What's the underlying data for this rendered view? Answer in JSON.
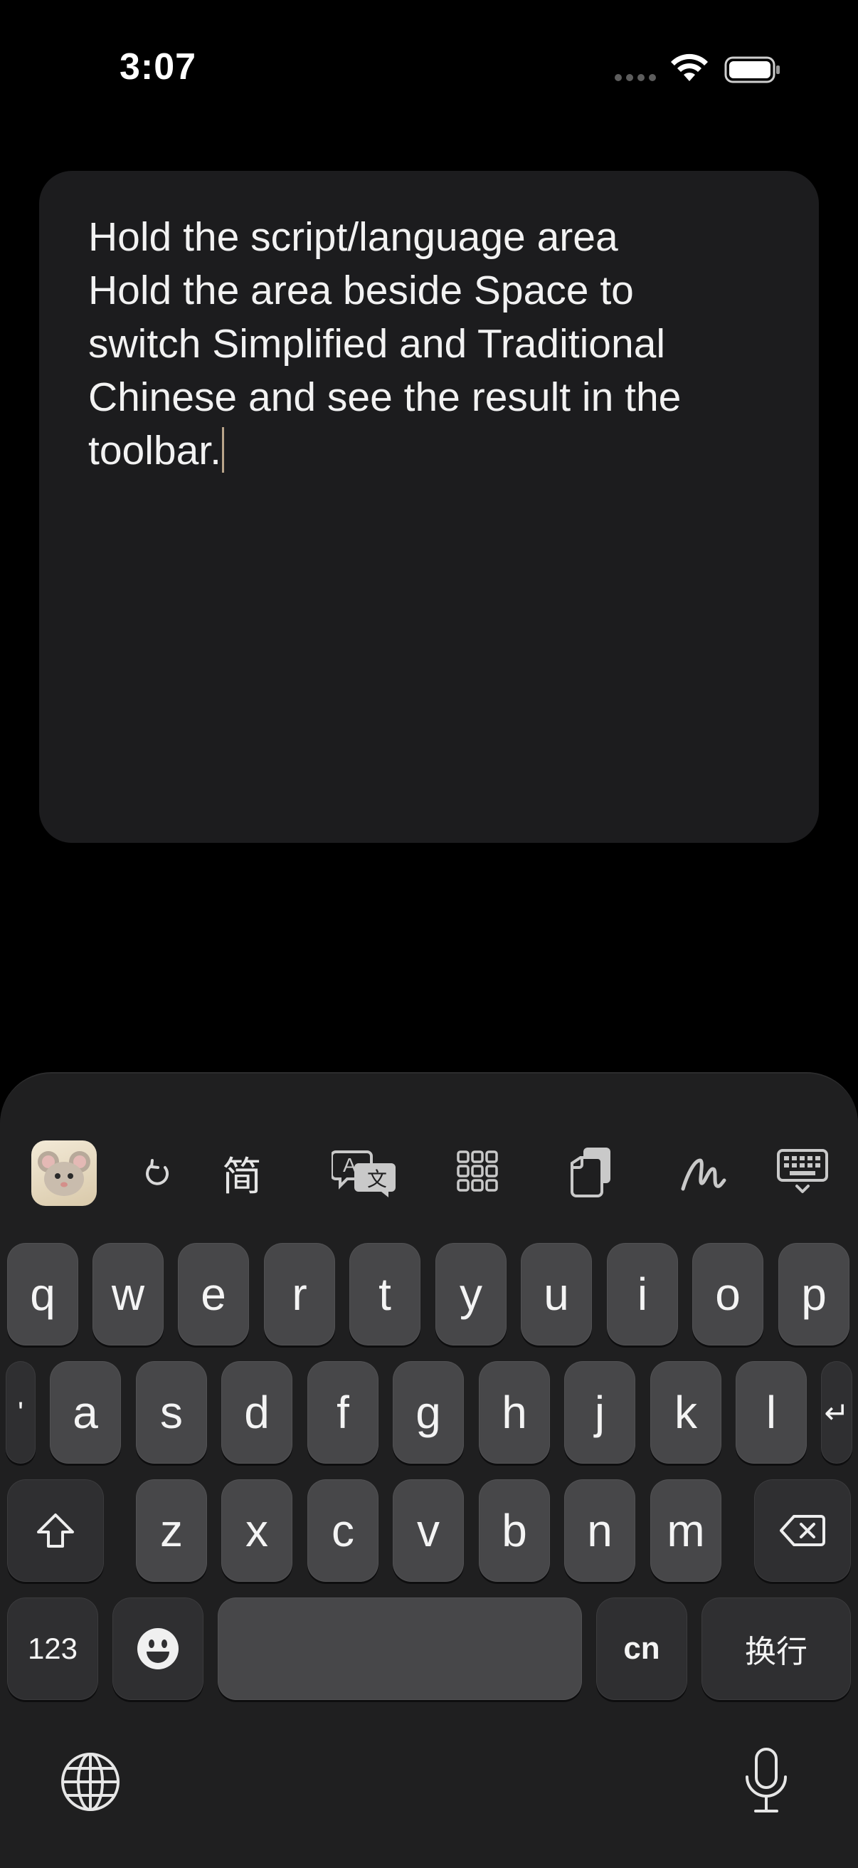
{
  "status_bar": {
    "time": "3:07"
  },
  "editor": {
    "text": "Hold the script/language area\nHold the area beside Space to switch Simplified and Traditional Chinese and see the result in the toolbar."
  },
  "toolbar": {
    "items": [
      {
        "name": "app-logo-icon"
      },
      {
        "name": "refresh-icon"
      },
      {
        "name": "script-toggle",
        "label": "简"
      },
      {
        "name": "translate-icon"
      },
      {
        "name": "grid-icon"
      },
      {
        "name": "clipboard-icon"
      },
      {
        "name": "handwriting-icon"
      },
      {
        "name": "keyboard-dismiss-icon"
      }
    ]
  },
  "keyboard": {
    "row1": [
      "q",
      "w",
      "e",
      "r",
      "t",
      "y",
      "u",
      "i",
      "o",
      "p"
    ],
    "row2": [
      "'",
      "a",
      "s",
      "d",
      "f",
      "g",
      "h",
      "j",
      "k",
      "l",
      "↵"
    ],
    "row3": [
      "z",
      "x",
      "c",
      "v",
      "b",
      "n",
      "m"
    ],
    "row4": {
      "numbers": "123",
      "space": "",
      "lang": "cn",
      "return": "换行"
    }
  },
  "colors": {
    "key": "#474749",
    "keyboard_bg": "#1f1f20",
    "card_bg": "#1c1c1e"
  }
}
